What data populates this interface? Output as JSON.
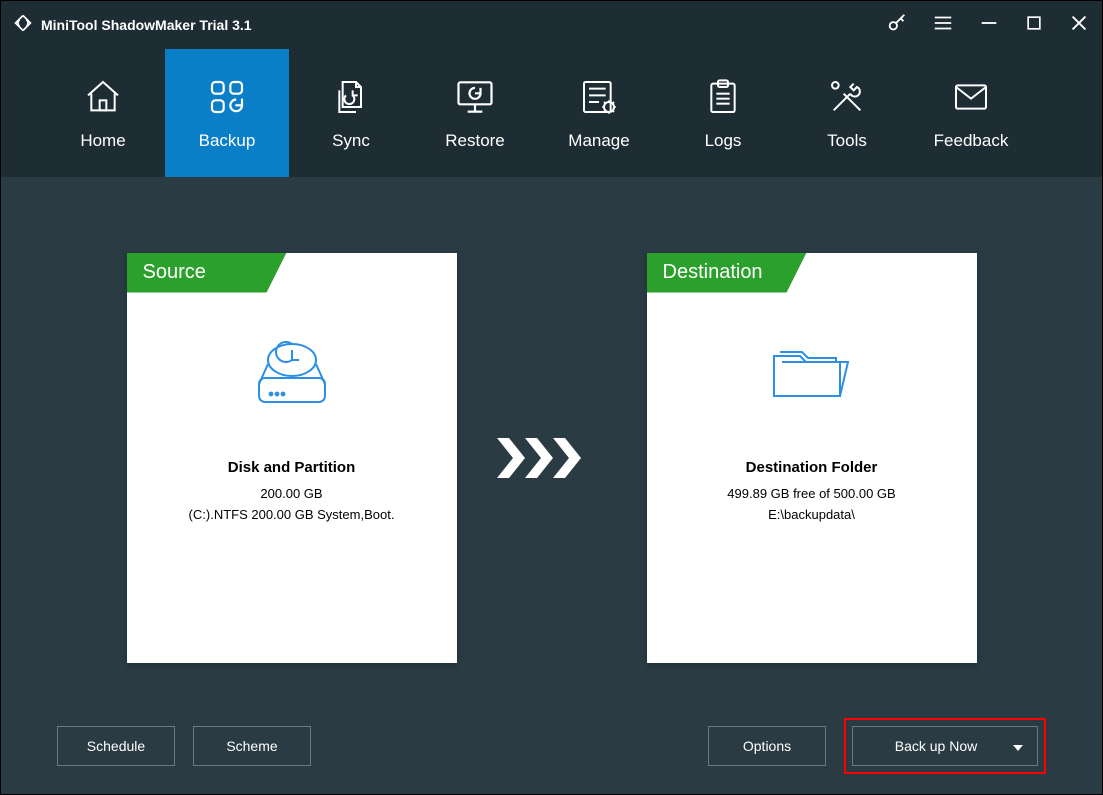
{
  "app_title": "MiniTool ShadowMaker Trial 3.1",
  "nav": [
    {
      "label": "Home"
    },
    {
      "label": "Backup"
    },
    {
      "label": "Sync"
    },
    {
      "label": "Restore"
    },
    {
      "label": "Manage"
    },
    {
      "label": "Logs"
    },
    {
      "label": "Tools"
    },
    {
      "label": "Feedback"
    }
  ],
  "source": {
    "tab": "Source",
    "title": "Disk and Partition",
    "size": "200.00 GB",
    "detail": "(C:).NTFS 200.00 GB System,Boot."
  },
  "destination": {
    "tab": "Destination",
    "title": "Destination Folder",
    "free": "499.89 GB free of 500.00 GB",
    "path": "E:\\backupdata\\"
  },
  "buttons": {
    "schedule": "Schedule",
    "scheme": "Scheme",
    "options": "Options",
    "backup_now": "Back up Now"
  }
}
